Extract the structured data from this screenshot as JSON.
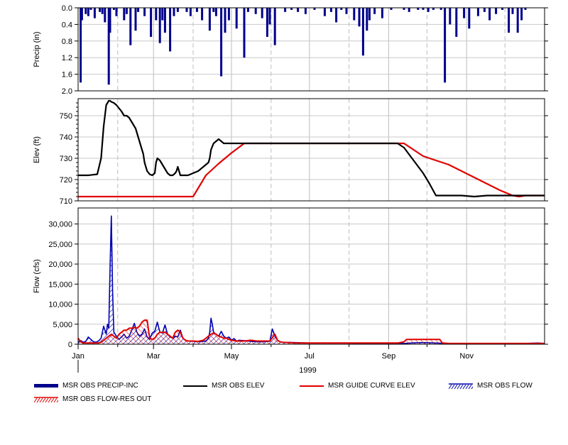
{
  "chart_data": [
    {
      "type": "bar",
      "panel": "precip",
      "ylabel": "Precip (in)",
      "ylim": [
        0,
        2.0
      ],
      "inverted_y": true,
      "yticks": [
        "0.0",
        "0.4",
        "0.8",
        "1.2",
        "1.6",
        "2.0"
      ],
      "series": [
        {
          "name": "MSR OBS PRECIP-INC",
          "color": "#00008b",
          "x": [
            2,
            3,
            6,
            8,
            10,
            13,
            17,
            19,
            21,
            24,
            25,
            28,
            30,
            36,
            38,
            41,
            45,
            47,
            52,
            57,
            61,
            64,
            66,
            68,
            72,
            75,
            78,
            85,
            88,
            93,
            97,
            103,
            106,
            108,
            112,
            115,
            118,
            124,
            130,
            133,
            139,
            144,
            148,
            150,
            154,
            162,
            167,
            172,
            178,
            185,
            193,
            198,
            202,
            206,
            210,
            216,
            220,
            223,
            226,
            228,
            232,
            238,
            245,
            255,
            259,
            266,
            270,
            274,
            278,
            284,
            287,
            291,
            296,
            302,
            306,
            313,
            318,
            322,
            327,
            332,
            337,
            340,
            344,
            347,
            350
          ],
          "values": [
            1.8,
            0.3,
            0.15,
            0.2,
            0.05,
            0.25,
            0.1,
            0.15,
            0.35,
            1.85,
            0.6,
            0.05,
            0.2,
            0.3,
            0.15,
            0.9,
            0.55,
            0.1,
            0.2,
            0.7,
            0.3,
            0.85,
            0.3,
            0.6,
            1.05,
            0.2,
            0.1,
            0.1,
            0.2,
            0.1,
            0.3,
            0.55,
            0.1,
            0.2,
            1.65,
            0.6,
            0.3,
            0.5,
            1.2,
            0.1,
            0.15,
            0.25,
            0.7,
            0.4,
            0.9,
            0.1,
            0.05,
            0.1,
            0.15,
            0.05,
            0.2,
            0.1,
            0.35,
            0.05,
            0.15,
            0.3,
            0.45,
            1.15,
            0.55,
            0.3,
            0.15,
            0.25,
            0.05,
            0.05,
            0.1,
            0.05,
            0.05,
            0.1,
            0.05,
            0.05,
            1.8,
            0.4,
            0.7,
            0.25,
            0.5,
            0.2,
            0.1,
            0.3,
            0.15,
            0.05,
            0.6,
            0.15,
            0.6,
            0.3,
            0.05
          ]
        }
      ]
    },
    {
      "type": "line",
      "panel": "elev",
      "ylabel": "Elev (ft)",
      "ylim": [
        710,
        758
      ],
      "yticks": [
        "710",
        "720",
        "730",
        "740",
        "750"
      ],
      "series": [
        {
          "name": "MSR OBS ELEV",
          "color": "#000000",
          "x": [
            0,
            8,
            15,
            18,
            20,
            22,
            24,
            25,
            26,
            28,
            30,
            34,
            36,
            38,
            40,
            42,
            45,
            47,
            49,
            51,
            52,
            54,
            56,
            58,
            60,
            61,
            62,
            64,
            66,
            68,
            70,
            72,
            74,
            76,
            77,
            78,
            79,
            80,
            82,
            86,
            90,
            94,
            98,
            100,
            102,
            103,
            104,
            106,
            108,
            110,
            112,
            114,
            116,
            118,
            120,
            124,
            130,
            135,
            140,
            145,
            150,
            160,
            175,
            190,
            210,
            225,
            235,
            240,
            245,
            250,
            255,
            260,
            265,
            270,
            275,
            280,
            290,
            300,
            310,
            320,
            330,
            340,
            350,
            360,
            365
          ],
          "values": [
            722,
            722,
            722.5,
            730,
            745,
            755,
            757,
            757,
            756.5,
            756,
            755,
            752,
            750,
            750,
            749,
            747,
            744,
            740,
            736,
            732,
            728,
            724,
            722.5,
            722,
            723,
            728,
            730,
            729,
            727,
            725,
            723,
            722,
            722,
            723,
            724,
            726,
            724,
            722,
            722,
            722,
            723,
            724,
            726,
            727,
            728,
            730,
            734,
            737,
            738,
            739,
            738,
            737,
            737,
            737,
            737,
            737,
            737,
            737,
            737,
            737,
            737,
            737,
            737,
            737,
            737,
            737,
            737,
            737,
            737,
            737,
            735,
            731,
            727,
            723,
            718,
            712.5,
            712.5,
            712.5,
            712,
            712.5,
            712.5,
            712.5,
            712.5,
            712.5,
            712.5
          ]
        },
        {
          "name": "MSR GUIDE CURVE ELEV",
          "color": "#e00000",
          "x": [
            0,
            90,
            95,
            100,
            110,
            120,
            130,
            140,
            150,
            200,
            250,
            255,
            260,
            270,
            280,
            290,
            300,
            310,
            320,
            330,
            340,
            345,
            350,
            365
          ],
          "values": [
            712,
            712,
            717,
            722,
            727.5,
            732.5,
            737,
            737,
            737,
            737,
            737,
            737,
            735,
            731,
            729,
            727,
            724,
            721,
            718,
            715,
            712.5,
            712,
            712.5,
            712.5
          ]
        }
      ]
    },
    {
      "type": "area",
      "panel": "flow",
      "ylabel": "Flow (cfs)",
      "ylim": [
        0,
        34000
      ],
      "yticks": [
        "0",
        "5,000",
        "10,000",
        "15,000",
        "20,000",
        "25,000",
        "30,000"
      ],
      "categories": [
        "Jan",
        "Mar",
        "May",
        "Jul",
        "Sep",
        "Nov"
      ],
      "xlabel": "1999",
      "series": [
        {
          "name": "MSR OBS FLOW",
          "color": "#0000b0",
          "x": [
            0,
            2,
            4,
            6,
            8,
            10,
            12,
            14,
            16,
            18,
            19,
            20,
            21,
            22,
            23,
            24,
            25,
            26,
            27,
            28,
            30,
            32,
            34,
            36,
            38,
            40,
            42,
            44,
            46,
            48,
            50,
            52,
            54,
            56,
            58,
            60,
            62,
            64,
            66,
            68,
            70,
            72,
            74,
            76,
            78,
            80,
            82,
            84,
            86,
            88,
            90,
            94,
            98,
            100,
            102,
            103,
            104,
            105,
            106,
            108,
            110,
            112,
            114,
            116,
            118,
            120,
            122,
            124,
            126,
            130,
            135,
            140,
            145,
            150,
            152,
            154,
            156,
            158,
            160,
            170,
            180,
            190,
            200,
            210,
            220,
            230,
            240,
            250,
            255,
            260,
            270,
            280,
            290,
            300,
            310,
            320,
            330,
            340,
            350,
            360,
            365
          ],
          "values": [
            500,
            900,
            500,
            700,
            1800,
            1200,
            600,
            500,
            800,
            1500,
            3000,
            4500,
            3500,
            2500,
            5000,
            4000,
            19000,
            32000,
            13000,
            3000,
            2000,
            1200,
            1800,
            2500,
            1500,
            2000,
            3500,
            5200,
            3000,
            2000,
            2500,
            3800,
            1800,
            1200,
            2800,
            3200,
            5500,
            3000,
            2800,
            4800,
            2500,
            1800,
            1500,
            2000,
            1800,
            3500,
            1500,
            1000,
            800,
            800,
            700,
            600,
            700,
            800,
            1500,
            3000,
            6500,
            5000,
            3000,
            2500,
            2000,
            3200,
            2000,
            1500,
            1800,
            1000,
            1400,
            800,
            1000,
            900,
            700,
            600,
            600,
            700,
            3800,
            2000,
            1000,
            600,
            500,
            400,
            300,
            300,
            300,
            300,
            200,
            200,
            200,
            200,
            200,
            300,
            400,
            300,
            200,
            200,
            200,
            200,
            200,
            200,
            200,
            300,
            200
          ]
        },
        {
          "name": "MSR OBS FLOW-RES OUT",
          "color": "#e00000",
          "x": [
            0,
            2,
            4,
            6,
            8,
            10,
            12,
            14,
            16,
            18,
            20,
            22,
            24,
            26,
            28,
            30,
            32,
            34,
            36,
            38,
            40,
            42,
            44,
            46,
            48,
            50,
            52,
            54,
            56,
            58,
            60,
            62,
            64,
            66,
            68,
            70,
            72,
            74,
            76,
            78,
            80,
            82,
            84,
            86,
            88,
            90,
            94,
            98,
            100,
            102,
            104,
            106,
            108,
            110,
            112,
            114,
            116,
            118,
            120,
            124,
            130,
            135,
            140,
            145,
            150,
            154,
            156,
            158,
            160,
            170,
            180,
            190,
            200,
            210,
            220,
            230,
            240,
            250,
            255,
            257,
            260,
            270,
            280,
            283,
            285,
            290,
            300,
            310,
            320,
            330,
            340,
            350,
            360,
            365
          ],
          "values": [
            1500,
            600,
            300,
            300,
            300,
            300,
            300,
            300,
            300,
            500,
            1000,
            1500,
            2000,
            2500,
            2000,
            1500,
            2500,
            3000,
            3500,
            3500,
            4000,
            4000,
            4200,
            4000,
            4500,
            5500,
            6000,
            6000,
            1500,
            1200,
            1500,
            2500,
            3000,
            3000,
            3000,
            2500,
            2000,
            1500,
            3000,
            3500,
            3000,
            1500,
            1000,
            800,
            800,
            800,
            700,
            1000,
            1500,
            2000,
            2500,
            2800,
            2500,
            2000,
            1800,
            1500,
            1500,
            1200,
            1000,
            800,
            800,
            1000,
            800,
            800,
            800,
            2500,
            1000,
            600,
            500,
            300,
            300,
            300,
            300,
            300,
            300,
            300,
            300,
            300,
            600,
            1200,
            1200,
            1200,
            1200,
            1200,
            300,
            200,
            200,
            200,
            200,
            200,
            200,
            200,
            200,
            200
          ]
        }
      ]
    }
  ],
  "legend": [
    {
      "label": "MSR OBS PRECIP-INC",
      "style": "bar",
      "color": "#00008b"
    },
    {
      "label": "MSR OBS ELEV",
      "style": "line",
      "color": "#000000"
    },
    {
      "label": "MSR GUIDE CURVE ELEV",
      "style": "line",
      "color": "#e00000"
    },
    {
      "label": "MSR OBS FLOW",
      "style": "hatch",
      "color": "#0000b0"
    },
    {
      "label": "MSR OBS FLOW-RES OUT",
      "style": "hatch",
      "color": "#e00000"
    }
  ]
}
